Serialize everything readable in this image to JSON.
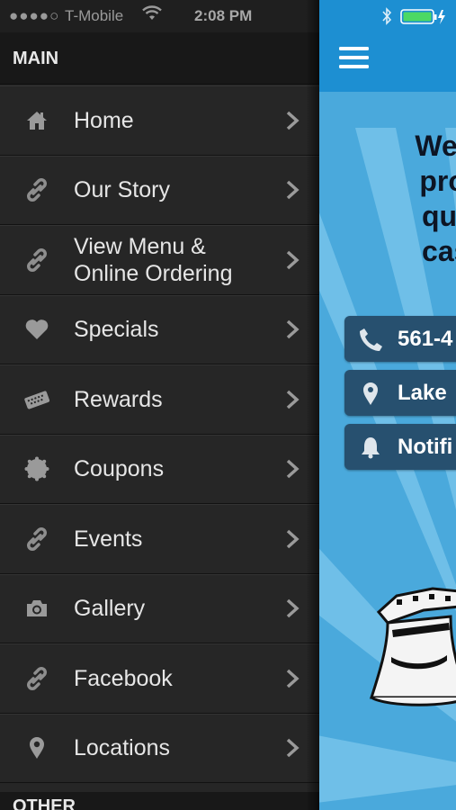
{
  "status_bar": {
    "signal": "●●●●○",
    "carrier": "T-Mobile",
    "time": "2:08 PM"
  },
  "menu": {
    "section_title": "MAIN",
    "other_title": "OTHER",
    "items": [
      {
        "label": "Home",
        "icon": "home-icon"
      },
      {
        "label": "Our Story",
        "icon": "link-icon"
      },
      {
        "label": "View Menu &\nOnline Ordering",
        "icon": "link-icon"
      },
      {
        "label": "Specials",
        "icon": "heart-icon"
      },
      {
        "label": "Rewards",
        "icon": "ticket-icon"
      },
      {
        "label": "Coupons",
        "icon": "badge-icon"
      },
      {
        "label": "Events",
        "icon": "link-icon"
      },
      {
        "label": "Gallery",
        "icon": "camera-icon"
      },
      {
        "label": "Facebook",
        "icon": "link-icon"
      },
      {
        "label": "Locations",
        "icon": "pin-icon"
      }
    ]
  },
  "main": {
    "headline_lines": [
      "We pr",
      "provi",
      "quality",
      "casu"
    ],
    "buttons": [
      {
        "label": "561-4",
        "icon": "phone-icon"
      },
      {
        "label": "Lake",
        "icon": "location-icon"
      },
      {
        "label": "Notifi",
        "icon": "bell-icon"
      }
    ]
  },
  "colors": {
    "drawer_bg": "#262626",
    "header_blue": "#1d8fd2",
    "content_blue": "#5cb6e3",
    "pill_bg": "#27506f",
    "battery_green": "#4cd964"
  }
}
